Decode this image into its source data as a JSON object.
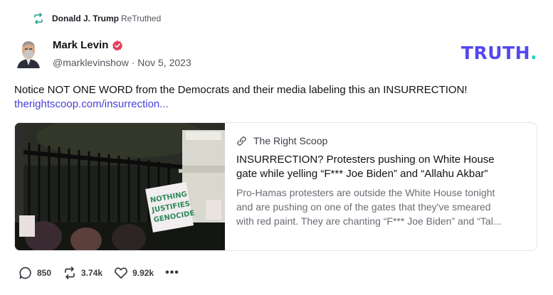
{
  "retruth": {
    "icon": "retruth-icon",
    "user": "Donald J. Trump",
    "action": "ReTruthed"
  },
  "post": {
    "author_name": "Mark Levin",
    "verified_icon": "verified-badge-icon",
    "handle_date": "@marklevinshow · Nov 5, 2023",
    "text": "Notice NOT ONE WORD from the Democrats and their media labeling this an INSURRECTION!",
    "link": "therightscoop.com/insurrection..."
  },
  "brand": {
    "text": "TRUTH",
    "dot": ".",
    "color": "#5448ee",
    "dot_color": "#1fd3c0"
  },
  "card": {
    "source_icon": "link-icon",
    "source": "The Right Scoop",
    "title": "INSURRECTION? Protesters pushing on White House gate while yelling “F*** Joe Biden” and “Allahu Akbar”",
    "description": "Pro-Hamas protesters are outside the White House tonight and are pushing on one of the gates that they've smeared with red paint. They are chanting “F*** Joe Biden” and “Tal...",
    "image_sign_lines": [
      "NOTHING",
      "JUSTIFIES",
      "GENOCIDE"
    ]
  },
  "actions": {
    "replies": "850",
    "retruths": "3.74k",
    "likes": "9.92k",
    "more": "•••"
  }
}
